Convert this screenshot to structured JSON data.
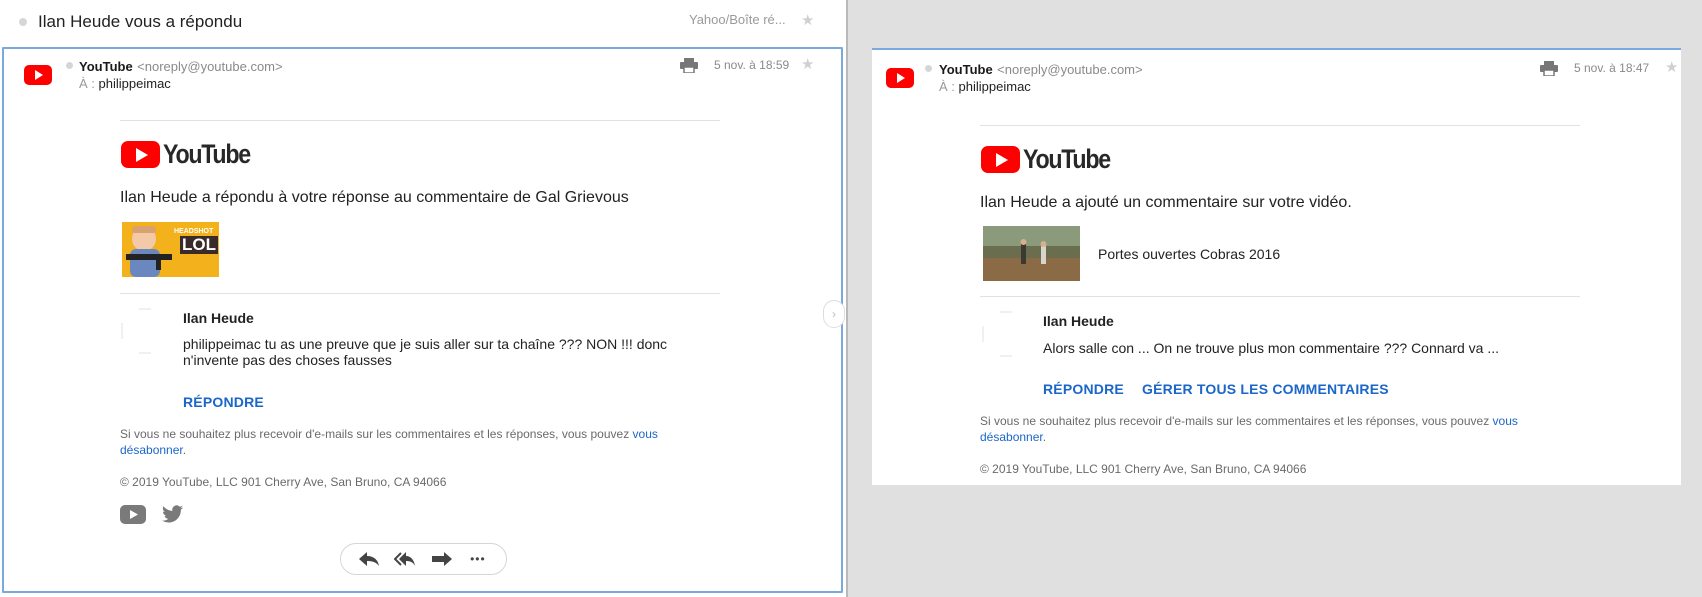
{
  "left": {
    "thread_title": "Ilan Heude vous a répondu",
    "thread_folder": "Yahoo/Boîte ré...",
    "star": "★",
    "message": {
      "sender_name": "YouTube",
      "sender_email": "<noreply@youtube.com>",
      "to_label": "À :",
      "to_value": "philippeimac",
      "date": "5 nov. à 18:59",
      "logo_word": "YouTube",
      "headline": "Ilan Heude a répondu à votre réponse au commentaire de Gal Grievous",
      "thumb_caption_top": "HEADSHOT",
      "thumb_caption": "LOL",
      "comment_author": "Ilan Heude",
      "comment_text": "philippeimac tu as une preuve que je suis aller sur ta chaîne ??? NON !!! donc n'invente pas des choses fausses",
      "reply_label": "RÉPONDRE",
      "unsubscribe_text": "Si vous ne souhaitez plus recevoir d'e-mails sur les commentaires et les réponses, vous pouvez",
      "unsubscribe_link": "vous désabonner",
      "unsubscribe_end": ".",
      "copyright": "© 2019 YouTube, LLC 901 Cherry Ave, San Bruno, CA 94066",
      "social_icons": [
        "youtube-icon",
        "twitter-icon"
      ]
    },
    "action_bar": [
      "reply-icon",
      "reply-all-icon",
      "forward-icon",
      "more-icon"
    ],
    "more_glyph": "•••",
    "pane_toggle": "›"
  },
  "right": {
    "message": {
      "sender_name": "YouTube",
      "sender_email": "<noreply@youtube.com>",
      "to_label": "À :",
      "to_value": "philippeimac",
      "date": "5 nov. à 18:47",
      "star": "★",
      "logo_word": "YouTube",
      "headline": "Ilan Heude a ajouté un commentaire sur votre vidéo.",
      "video_title": "Portes ouvertes Cobras 2016",
      "comment_author": "Ilan Heude",
      "comment_text": "Alors salle con ... On ne trouve plus mon commentaire ??? Connard va ...",
      "reply_label": "RÉPONDRE",
      "manage_label": "GÉRER TOUS LES COMMENTAIRES",
      "unsubscribe_text": "Si vous ne souhaitez plus recevoir d'e-mails sur les commentaires et les réponses, vous pouvez",
      "unsubscribe_link": "vous désabonner",
      "unsubscribe_end": ".",
      "copyright": "© 2019 YouTube, LLC 901 Cherry Ave, San Bruno, CA 94066"
    }
  },
  "colors": {
    "accent_blue": "#1a66c9",
    "youtube_red": "#ff0000",
    "selection_border": "#7aa9e0"
  }
}
